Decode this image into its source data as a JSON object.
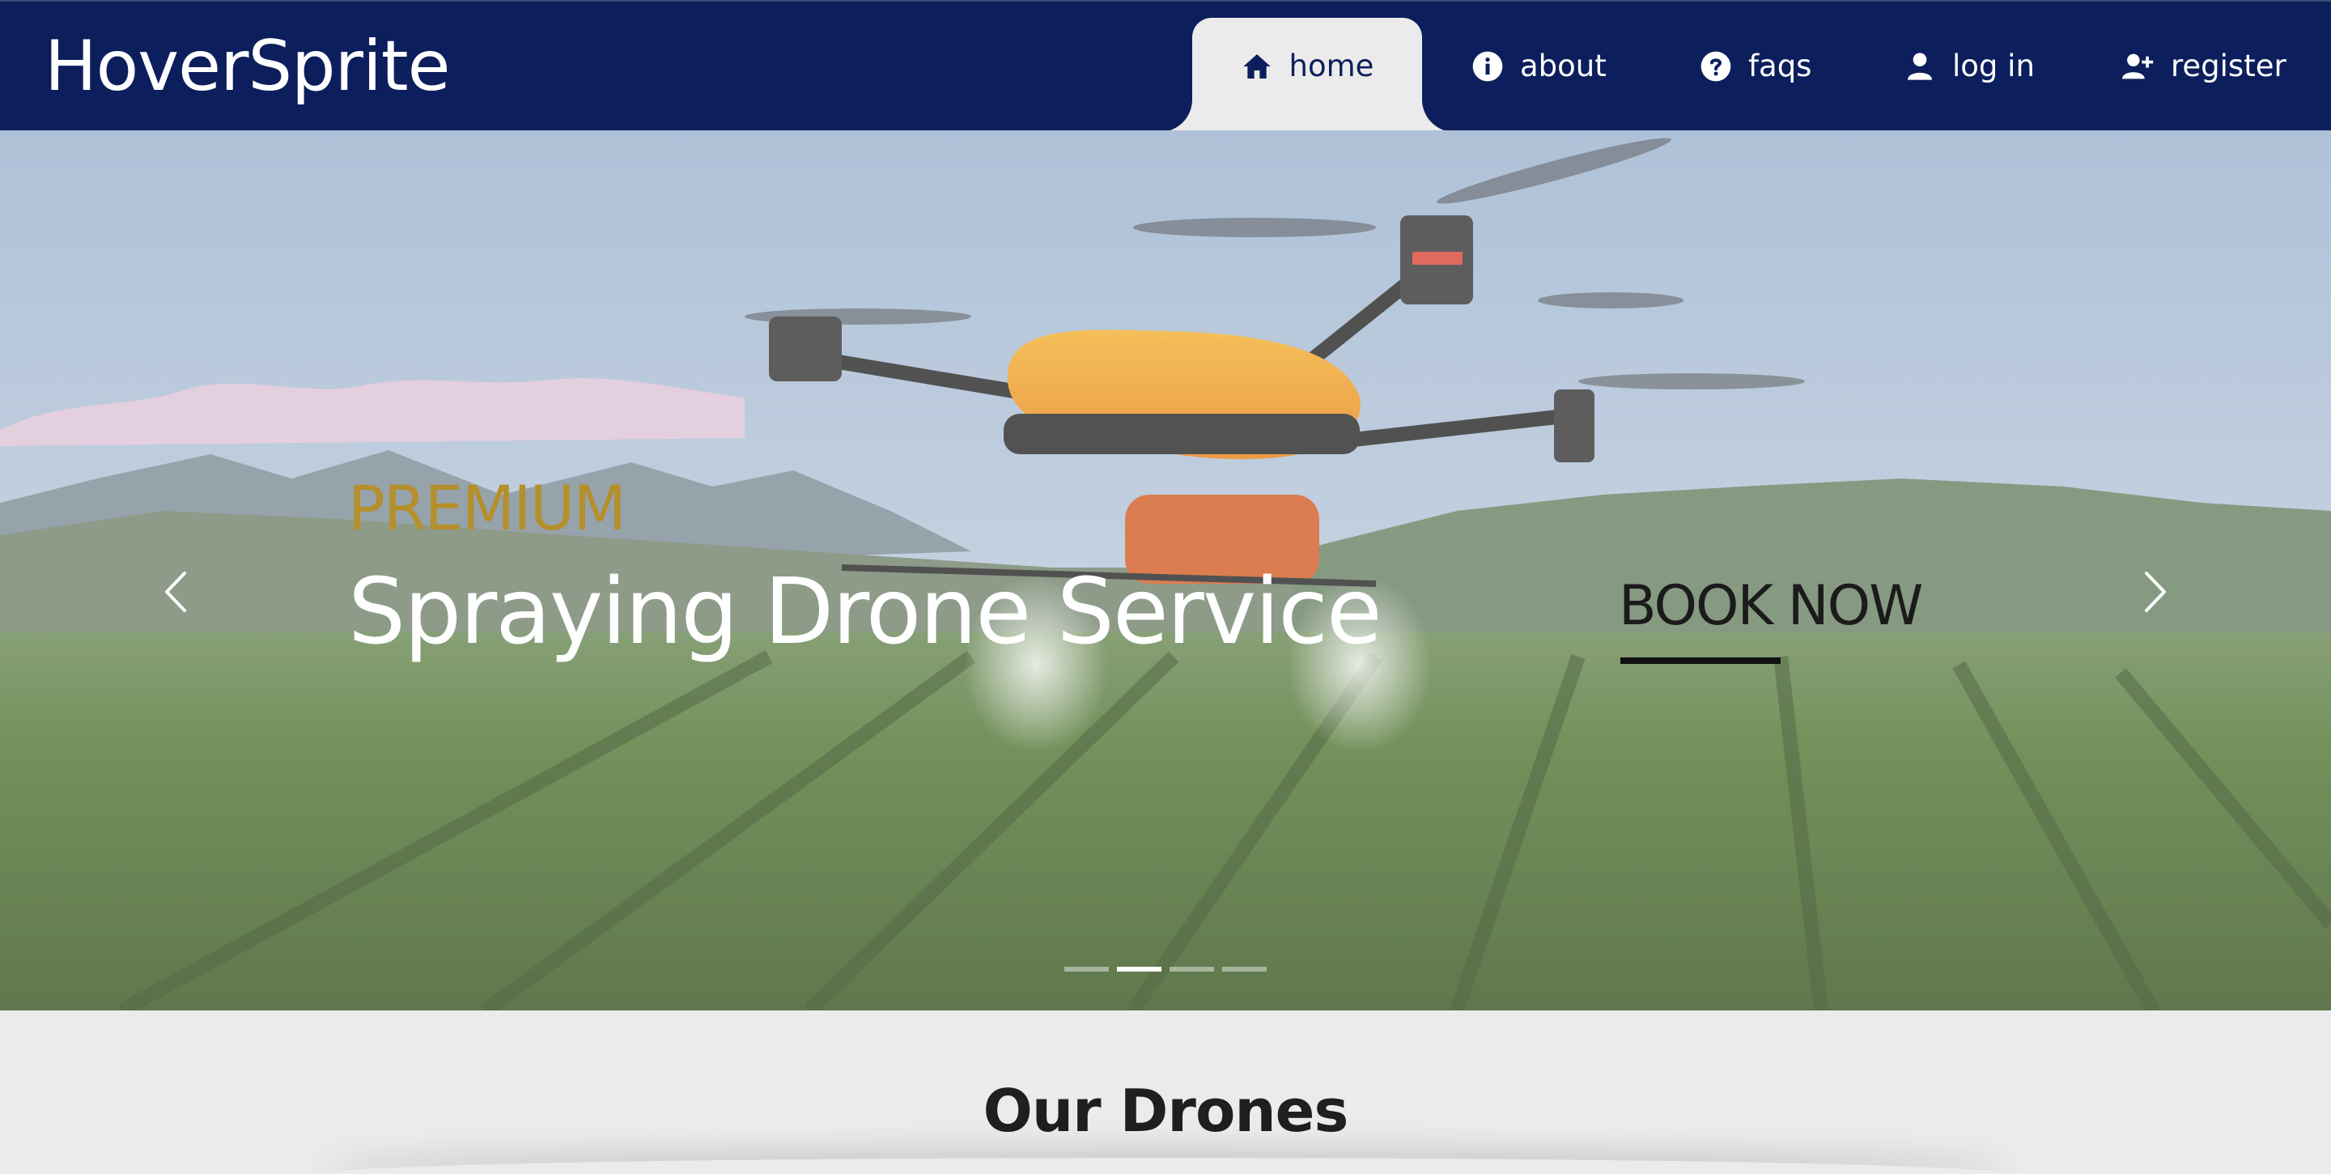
{
  "brand": {
    "name": "HoverSprite"
  },
  "nav": {
    "items": [
      {
        "label": "home",
        "icon": "home-icon",
        "active": true
      },
      {
        "label": "about",
        "icon": "info-circle-icon",
        "active": false
      },
      {
        "label": "faqs",
        "icon": "question-circle-icon",
        "active": false
      },
      {
        "label": "log in",
        "icon": "user-icon",
        "active": false
      },
      {
        "label": "register",
        "icon": "user-plus-icon",
        "active": false
      }
    ]
  },
  "hero": {
    "eyebrow": "PREMIUM",
    "headline": "Spraying Drone Service",
    "cta_label": "BOOK NOW",
    "slide_count": 4,
    "active_slide": 2
  },
  "section": {
    "title": "Our Drones"
  },
  "colors": {
    "nav_bg": "#0c1f5c",
    "page_bg": "#ebebeb",
    "accent_gold": "#b48f2c"
  }
}
